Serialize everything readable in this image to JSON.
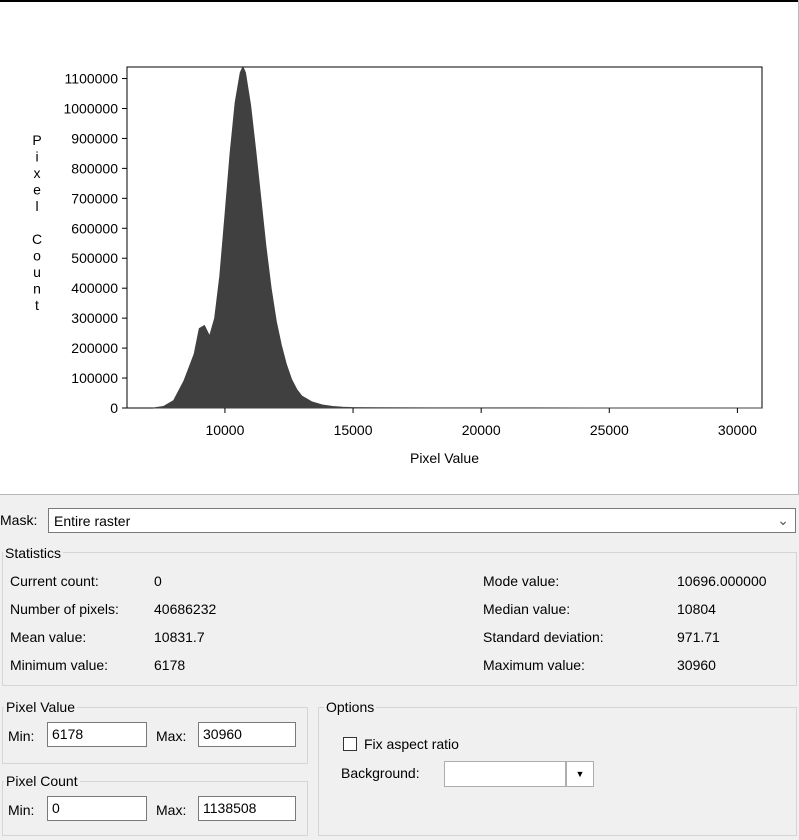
{
  "chart_data": {
    "type": "area",
    "xlabel": "Pixel Value",
    "ylabel": "Pixel Count",
    "xlim": [
      6178,
      30960
    ],
    "ylim": [
      0,
      1138508
    ],
    "x_ticks": [
      "10000",
      "15000",
      "20000",
      "25000",
      "30000"
    ],
    "x_tick_values": [
      10000,
      15000,
      20000,
      25000,
      30000
    ],
    "y_ticks": [
      "0",
      "100000",
      "200000",
      "300000",
      "400000",
      "500000",
      "600000",
      "700000",
      "800000",
      "900000",
      "1000000",
      "1100000"
    ],
    "y_tick_values": [
      0,
      100000,
      200000,
      300000,
      400000,
      500000,
      600000,
      700000,
      800000,
      900000,
      1000000,
      1100000
    ],
    "x": [
      7200,
      7600,
      8000,
      8400,
      8800,
      9000,
      9200,
      9400,
      9600,
      9800,
      10000,
      10200,
      10400,
      10600,
      10700,
      10800,
      11000,
      11200,
      11400,
      11600,
      11800,
      12000,
      12200,
      12400,
      12600,
      12800,
      13000,
      13400,
      13800,
      14200,
      14600,
      15000,
      16000,
      18000,
      20000,
      22000,
      24000,
      26000,
      28000,
      30960
    ],
    "y": [
      0,
      5000,
      25000,
      90000,
      180000,
      265000,
      275000,
      240000,
      300000,
      440000,
      640000,
      850000,
      1020000,
      1120000,
      1138508,
      1120000,
      1010000,
      860000,
      700000,
      540000,
      400000,
      290000,
      210000,
      145000,
      95000,
      62000,
      40000,
      20000,
      10000,
      5000,
      2500,
      1200,
      600,
      400,
      300,
      200,
      150,
      80,
      40,
      0
    ]
  },
  "mask": {
    "label": "Mask:",
    "value": "Entire raster"
  },
  "statistics": {
    "title": "Statistics",
    "current_count_label": "Current count:",
    "current_count": "0",
    "num_pixels_label": "Number of pixels:",
    "num_pixels": "40686232",
    "mean_label": "Mean value:",
    "mean": "10831.7",
    "min_label": "Minimum value:",
    "min": "6178",
    "mode_label": "Mode value:",
    "mode": "10696.000000",
    "median_label": "Median value:",
    "median": "10804",
    "stddev_label": "Standard deviation:",
    "stddev": "971.71",
    "max_label": "Maximum value:",
    "max": "30960"
  },
  "pixel_value": {
    "title": "Pixel Value",
    "min_label": "Min:",
    "min": "6178",
    "max_label": "Max:",
    "max": "30960"
  },
  "pixel_count": {
    "title": "Pixel Count",
    "min_label": "Min:",
    "min": "0",
    "max_label": "Max:",
    "max": "1138508"
  },
  "options": {
    "title": "Options",
    "fix_aspect_label": "Fix aspect ratio",
    "fix_aspect_checked": false,
    "background_label": "Background:"
  },
  "colors": {
    "histogram_fill": "#404040",
    "panel_bg": "#f0f0f0"
  }
}
